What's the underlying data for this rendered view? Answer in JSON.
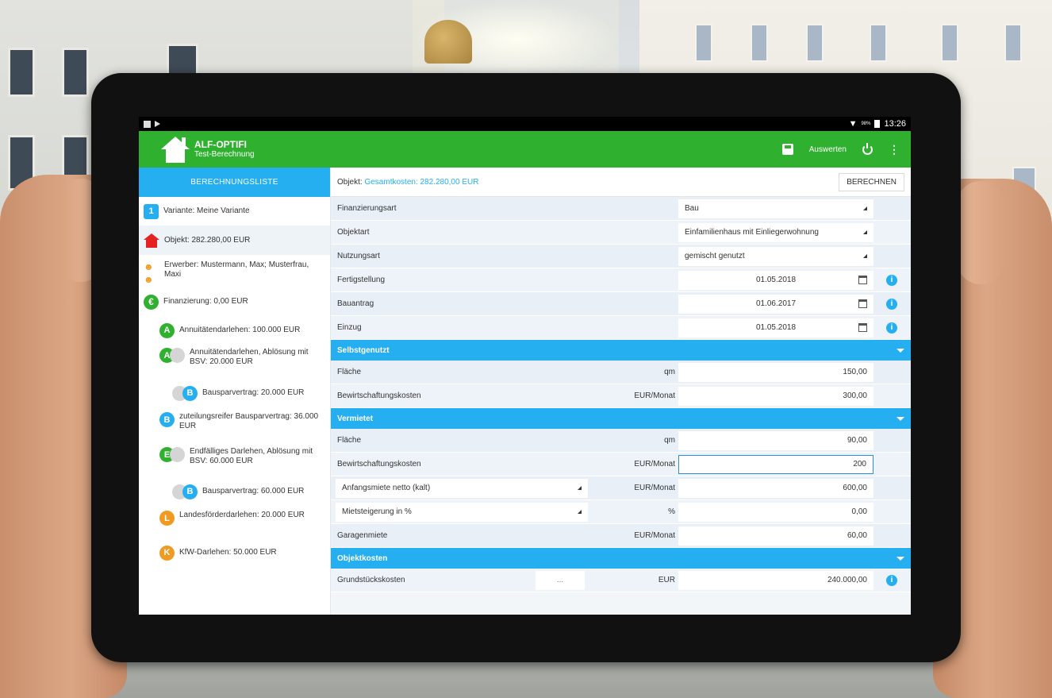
{
  "statusbar": {
    "time": "13:26",
    "battery": "98%"
  },
  "app": {
    "title": "ALF-OPTIFI",
    "subtitle": "Test-Berechnung"
  },
  "actions": {
    "evaluate": "Auswerten"
  },
  "sidebar": {
    "header": "BERECHNUNGSLISTE",
    "items": [
      {
        "badge": "1",
        "label": "Variante: Meine Variante"
      },
      {
        "label": "Objekt: 282.280,00 EUR"
      },
      {
        "label": "Erwerber: Mustermann, Max; Musterfrau, Maxi"
      },
      {
        "badge": "€",
        "label": "Finanzierung: 0,00 EUR"
      },
      {
        "badge": "A",
        "label": "Annuitätendarlehen: 100.000 EUR"
      },
      {
        "badge": "A",
        "badge2": "",
        "label": "Annuitätendarlehen, Ablösung mit BSV: 20.000 EUR"
      },
      {
        "badge": "",
        "badge2": "B",
        "label": "Bausparvertrag: 20.000 EUR"
      },
      {
        "badge": "B",
        "label": "zuteilungsreifer Bausparvertrag: 36.000 EUR"
      },
      {
        "badge": "E",
        "badge2": "",
        "label": "Endfälliges Darlehen, Ablösung mit BSV: 60.000 EUR"
      },
      {
        "badge": "",
        "badge2": "B",
        "label": "Bausparvertrag: 60.000 EUR"
      },
      {
        "badge": "L",
        "label": "Landesförderdarlehen: 20.000 EUR"
      },
      {
        "badge": "K",
        "label": "KfW-Darlehen: 50.000 EUR"
      }
    ]
  },
  "main": {
    "object_label": "Objekt:",
    "object_value": "Gesamtkosten: 282.280,00 EUR",
    "calc_button": "BERECHNEN",
    "rows": {
      "finanzierungsart": {
        "label": "Finanzierungsart",
        "value": "Bau"
      },
      "objektart": {
        "label": "Objektart",
        "value": "Einfamilienhaus mit Einliegerwohnung"
      },
      "nutzungsart": {
        "label": "Nutzungsart",
        "value": "gemischt genutzt"
      },
      "fertigstellung": {
        "label": "Fertigstellung",
        "value": "01.05.2018"
      },
      "bauantrag": {
        "label": "Bauantrag",
        "value": "01.06.2017"
      },
      "einzug": {
        "label": "Einzug",
        "value": "01.05.2018"
      }
    },
    "sections": {
      "selbst": "Selbstgenutzt",
      "vermietet": "Vermietet",
      "objektkosten": "Objektkosten"
    },
    "selbst": {
      "flaeche": {
        "label": "Fläche",
        "unit": "qm",
        "value": "150,00"
      },
      "bewirt": {
        "label": "Bewirtschaftungskosten",
        "unit": "EUR/Monat",
        "value": "300,00"
      }
    },
    "vermietet": {
      "flaeche": {
        "label": "Fläche",
        "unit": "qm",
        "value": "90,00"
      },
      "bewirt": {
        "label": "Bewirtschaftungskosten",
        "unit": "EUR/Monat",
        "value": "200"
      },
      "anfangsmiete": {
        "label": "Anfangsmiete netto (kalt)",
        "unit": "EUR/Monat",
        "value": "600,00"
      },
      "mietsteigerung": {
        "label": "Mietsteigerung in %",
        "unit": "%",
        "value": "0,00"
      },
      "garage": {
        "label": "Garagenmiete",
        "unit": "EUR/Monat",
        "value": "60,00"
      }
    },
    "objektkosten": {
      "grund": {
        "label": "Grundstückskosten",
        "dots": "...",
        "unit": "EUR",
        "value": "240.000,00"
      }
    }
  },
  "colors": {
    "appbar": "#2fb02f",
    "accent": "#25aef0",
    "badge_orange": "#f09a22",
    "house_red": "#e52222"
  },
  "icons": [
    "house-logo-icon",
    "save-icon",
    "power-icon",
    "more-icon",
    "calendar-icon",
    "info-icon",
    "dropdown-triangle-icon",
    "chevron-down-icon"
  ]
}
